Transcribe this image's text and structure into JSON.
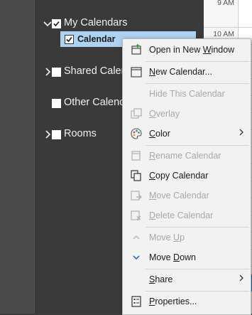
{
  "calendar_grid": {
    "time_labels": [
      "9 AM",
      "10 AM"
    ]
  },
  "folders": {
    "my_calendars": {
      "label": "My Calendars",
      "checked": true
    },
    "calendar_item": {
      "label": "Calendar",
      "checked": true,
      "selected": true
    },
    "shared": {
      "label": "Shared Calendars",
      "visible_text": "Shared Calen"
    },
    "other": {
      "label": "Other Calendars",
      "visible_text": "Other Calenc"
    },
    "rooms": {
      "label": "Rooms"
    }
  },
  "context_menu": {
    "items": [
      {
        "label": "Open in New Window",
        "enabled": true
      },
      {
        "label": "New Calendar...",
        "enabled": true
      },
      {
        "label": "Hide This Calendar",
        "enabled": false
      },
      {
        "label": "Overlay",
        "enabled": false
      },
      {
        "label": "Color",
        "enabled": true,
        "submenu": true
      },
      {
        "label": "Rename Calendar",
        "enabled": false
      },
      {
        "label": "Copy Calendar",
        "enabled": true
      },
      {
        "label": "Move Calendar",
        "enabled": false
      },
      {
        "label": "Delete Calendar",
        "enabled": false
      },
      {
        "label": "Move Up",
        "enabled": false
      },
      {
        "label": "Move Down",
        "enabled": true
      },
      {
        "label": "Share",
        "enabled": true,
        "submenu": true
      },
      {
        "label": "Properties...",
        "enabled": true
      }
    ]
  },
  "colors": {
    "selection": "#aed2f2",
    "accent_blue": "#1e7ad6",
    "pane_dark": "#3a3a3a",
    "menu_bg": "#f2f2f2"
  }
}
